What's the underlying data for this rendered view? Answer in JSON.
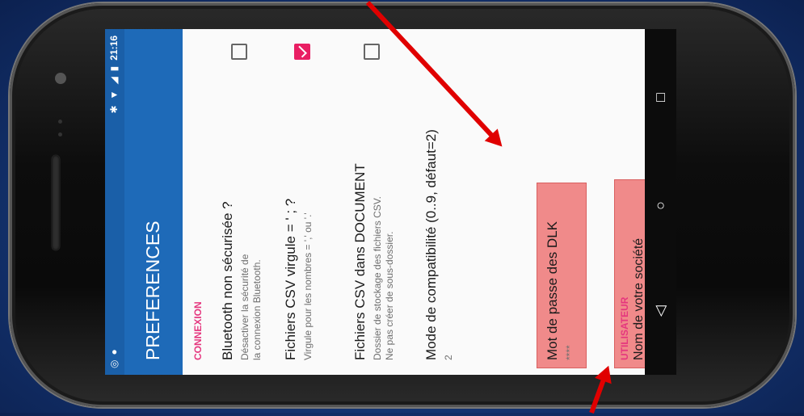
{
  "status_bar": {
    "left_icons": [
      "sync-icon",
      "android-icon"
    ],
    "right_icons": [
      "bluetooth-icon",
      "wifi-icon",
      "signal-icon",
      "battery-icon"
    ],
    "time": "21:16"
  },
  "toolbar": {
    "title": "PREFERENCES"
  },
  "sections": [
    {
      "header": "CONNEXION",
      "items": [
        {
          "title": "Bluetooth non sécurisée ?",
          "summary_line1": "Désactiver la sécurité de",
          "summary_line2": "la connexion Bluetooth.",
          "checked": false
        },
        {
          "title": "Fichiers CSV virgule = ' ; ?",
          "summary_line1": "Virgule pour les nombres = ',' ou '.'",
          "summary_line2": "",
          "checked": true
        },
        {
          "title": "Fichiers CSV dans DOCUMENT",
          "summary_line1": "Dossier de stockage des fichiers CSV.",
          "summary_line2": "Ne pas créer de sous-dossier.",
          "checked": false
        },
        {
          "title": "Mode de compatibilité (0..9, défaut=2)",
          "summary_line1": "2",
          "summary_line2": ""
        },
        {
          "title": "Mot de passe des DLK",
          "summary_line1": "****",
          "summary_line2": "",
          "highlighted": true
        }
      ]
    },
    {
      "header": "UTILISATEUR",
      "items": [
        {
          "title": "Nom de votre société",
          "summary_line1": "",
          "summary_line2": "",
          "highlighted": true
        }
      ]
    }
  ],
  "nav": {
    "back": "back-icon",
    "home": "home-icon",
    "recents": "recents-icon"
  },
  "colors": {
    "primary": "#1e6ab8",
    "accent": "#e91e63",
    "highlight": "#f08a8a",
    "annotation_arrow": "#e00000"
  }
}
